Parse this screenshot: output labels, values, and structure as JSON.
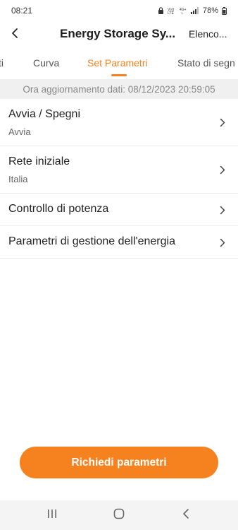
{
  "status_bar": {
    "time": "08:21",
    "battery": "78%"
  },
  "header": {
    "title": "Energy Storage Sy...",
    "action_label": "Elenco..."
  },
  "tabs": [
    {
      "label": "ti",
      "active": false
    },
    {
      "label": "Curva",
      "active": false
    },
    {
      "label": "Set Parametri",
      "active": true
    },
    {
      "label": "Stato di segn",
      "active": false
    }
  ],
  "update_banner": "Ora aggiornamento dati: 08/12/2023 20:59:05",
  "list": [
    {
      "title": "Avvia / Spegni",
      "subtitle": "Avvia"
    },
    {
      "title": "Rete iniziale",
      "subtitle": "Italia"
    },
    {
      "title": "Controllo di potenza"
    },
    {
      "title": "Parametri di gestione dell'energia"
    }
  ],
  "primary_button": "Richiedi parametri",
  "colors": {
    "accent": "#f5821f",
    "banner_bg": "#f0f0f0",
    "navbar_bg": "#f4f4f4"
  },
  "icons": {
    "back": "chevron-left-icon",
    "row_chevron": "chevron-right-icon",
    "nav": [
      "recent-apps-icon",
      "home-icon",
      "back-icon"
    ]
  }
}
